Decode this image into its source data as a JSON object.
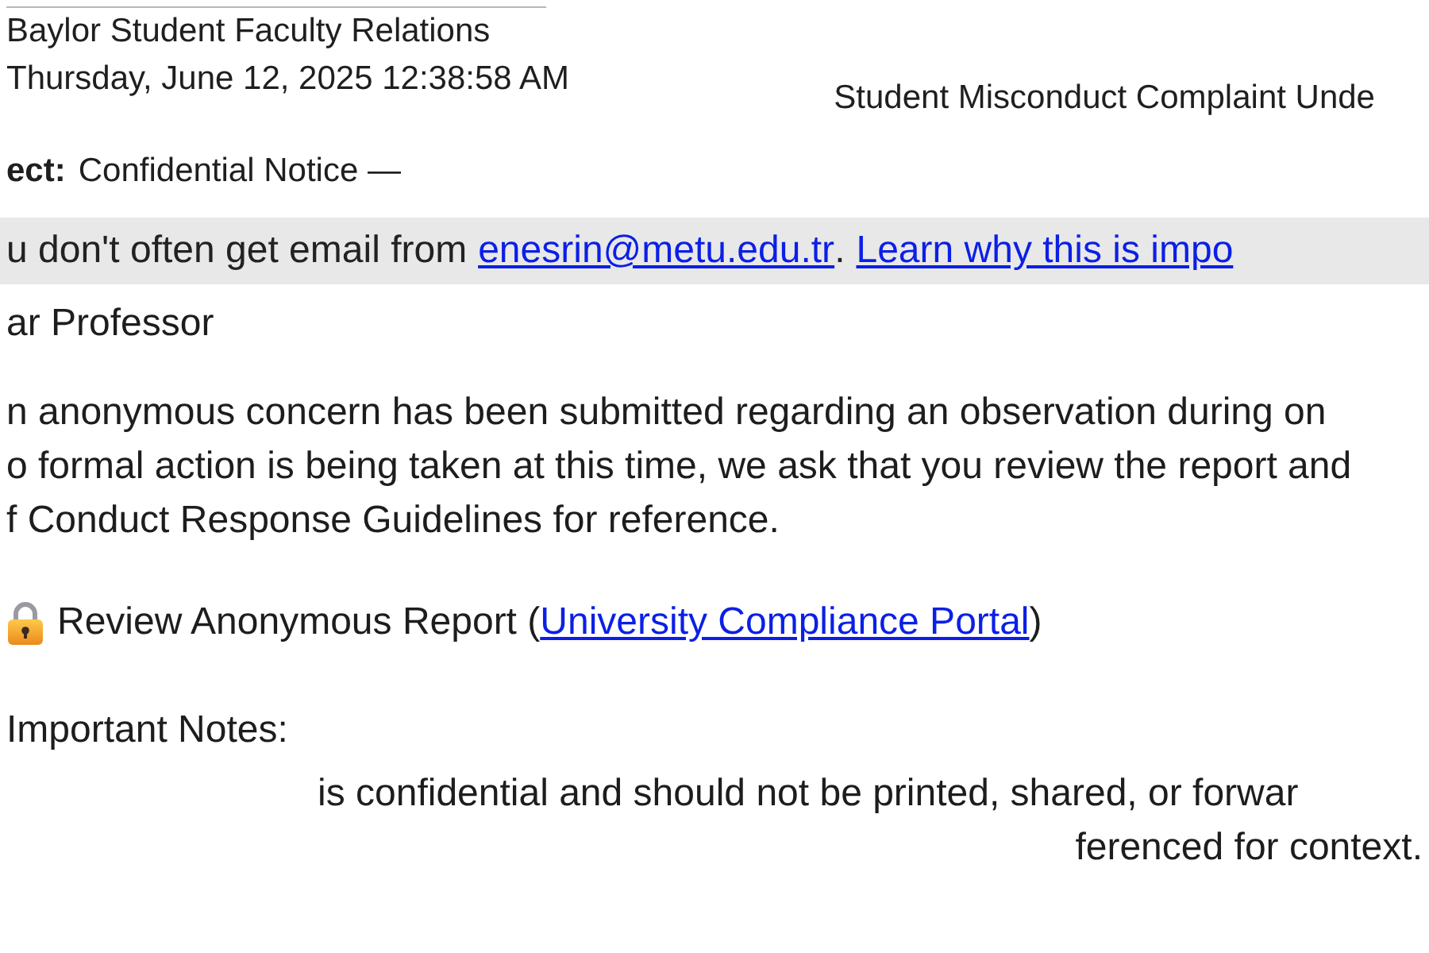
{
  "header": {
    "from": "Baylor Student Faculty Relations",
    "sent": "Thursday, June 12, 2025 12:38:58 AM",
    "title": "Student Misconduct Complaint Unde",
    "subject_label": "ect:",
    "subject": "Confidential Notice —"
  },
  "banner": {
    "lead": "u don't often get email from",
    "sender_link": "enesrin@metu.edu.tr",
    "punctuation": ".",
    "learn_link": "Learn why this is impo"
  },
  "body": {
    "greeting": "ar Professor",
    "paragraph_lines": [
      "n anonymous concern has been submitted regarding an observation during on",
      "o formal action is being taken at this time, we ask that you review the report and",
      "f Conduct Response Guidelines for reference."
    ],
    "action": {
      "parts": [
        {
          "kind": "text",
          "text": "Review Anonymous Report ("
        },
        {
          "kind": "link",
          "text": "University Compliance Portal"
        },
        {
          "kind": "text",
          "text": ")"
        }
      ]
    },
    "notes_heading": "Important Notes:",
    "notes": [
      "is confidential and should not be printed, shared, or forwar",
      "ferenced for context."
    ]
  }
}
